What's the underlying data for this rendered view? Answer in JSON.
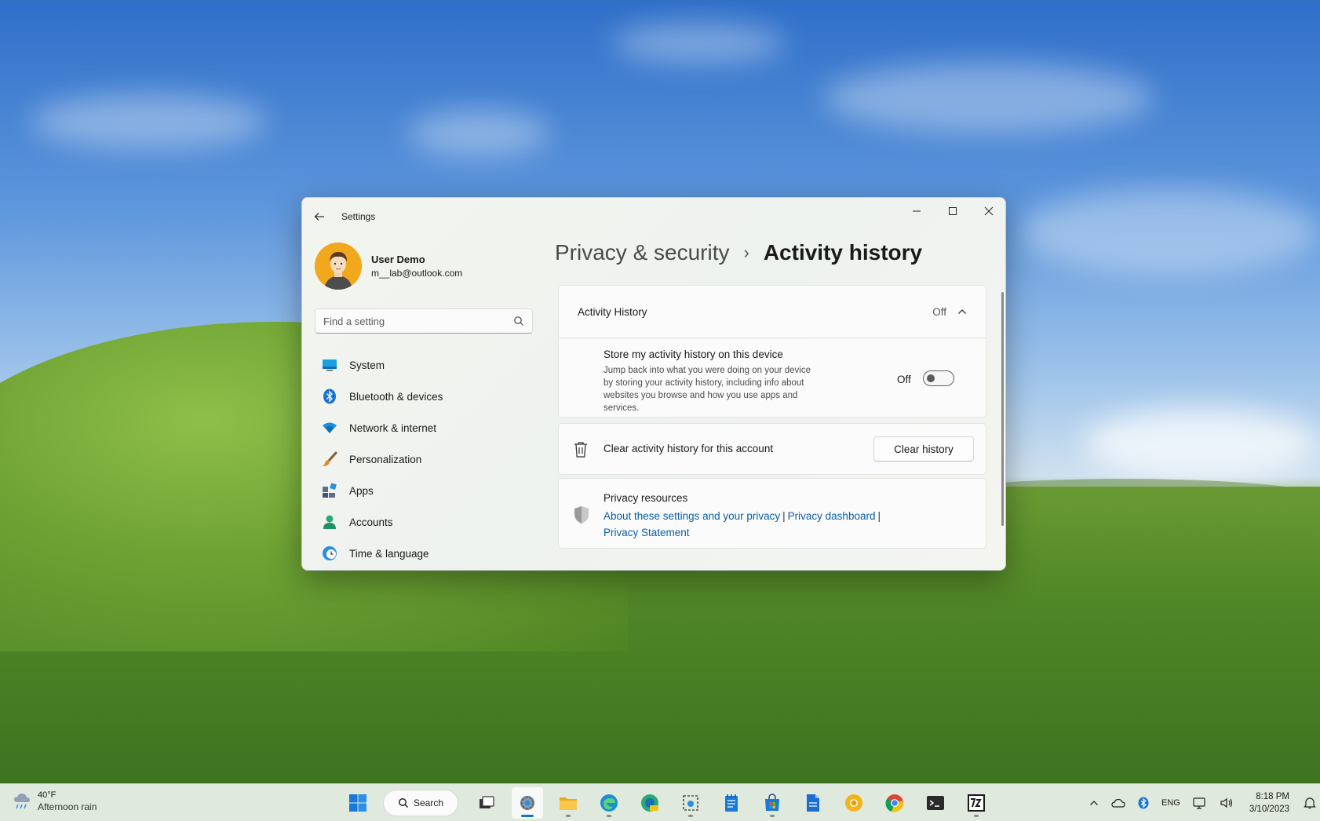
{
  "window": {
    "title": "Settings"
  },
  "profile": {
    "name": "User Demo",
    "email": "m__lab@outlook.com"
  },
  "search": {
    "placeholder": "Find a setting"
  },
  "nav": {
    "items": [
      {
        "label": "System",
        "icon": "system-icon"
      },
      {
        "label": "Bluetooth & devices",
        "icon": "bluetooth-icon"
      },
      {
        "label": "Network & internet",
        "icon": "wifi-icon"
      },
      {
        "label": "Personalization",
        "icon": "brush-icon"
      },
      {
        "label": "Apps",
        "icon": "apps-icon"
      },
      {
        "label": "Accounts",
        "icon": "accounts-icon"
      },
      {
        "label": "Time & language",
        "icon": "globe-clock-icon"
      }
    ]
  },
  "breadcrumb": {
    "parent": "Privacy & security",
    "separator": "›",
    "current": "Activity history"
  },
  "activity": {
    "header_title": "Activity History",
    "header_status": "Off",
    "store_title": "Store my activity history on this device",
    "store_desc": "Jump back into what you were doing on your device by storing your activity history, including info about websites you browse and how you use apps and services.",
    "toggle_label": "Off",
    "toggle_on": false,
    "clear_text": "Clear activity history for this account",
    "clear_button": "Clear history"
  },
  "resources": {
    "title": "Privacy resources",
    "link1": "About these settings and your privacy",
    "link2": "Privacy dashboard",
    "link3": "Privacy Statement",
    "separator": "|"
  },
  "taskbar": {
    "weather_temp": "40°F",
    "weather_desc": "Afternoon rain",
    "search_label": "Search",
    "language": "ENG",
    "time": "8:18 PM",
    "date": "3/10/2023"
  },
  "colors": {
    "accent": "#0a5ea8",
    "taskbar_active": "#1a6fd0"
  }
}
